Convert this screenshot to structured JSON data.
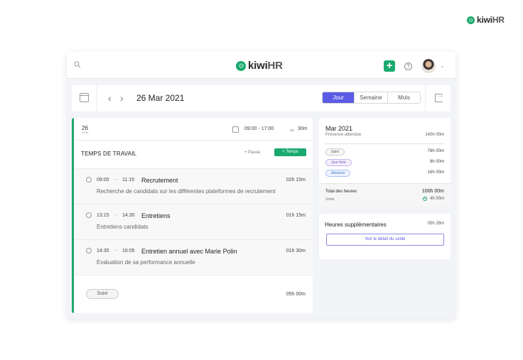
{
  "brand": {
    "name_main": "kiwi",
    "name_suffix": "HR",
    "color": "#1aaa6e"
  },
  "topbar": {
    "icons": [
      "search-icon",
      "plus-icon",
      "help-icon",
      "avatar",
      "chevron-down-icon"
    ]
  },
  "datebar": {
    "current_date": "26 Mar 2021",
    "view_options": [
      {
        "label": "Jour",
        "active": true
      },
      {
        "label": "Semaine",
        "active": false
      },
      {
        "label": "Mois",
        "active": false
      }
    ],
    "accent_color": "#5b5be6"
  },
  "day": {
    "day_number": "26",
    "day_of_week": "VEN",
    "schedule": "09:00 - 17:00",
    "pause": "30m",
    "section_title": "TEMPS DE TRAVAIL",
    "pause_button": "+ Pause",
    "temps_button": "+ Temps",
    "entries": [
      {
        "start": "09:00",
        "end": "11:15",
        "activity": "Recrutement",
        "duration": "02h 15m",
        "description": "Recherche de candidats sur les différentes plateformes de recrutement"
      },
      {
        "start": "13:15",
        "end": "14:30",
        "activity": "Entretiens",
        "duration": "01h 15m",
        "description": "Entretiens candidats"
      },
      {
        "start": "14:35",
        "end": "16:05",
        "activity": "Entretien annuel avec Marie Polin",
        "duration": "01h 30m",
        "description": "Evaluation de sa performance annuelle"
      }
    ],
    "footer_status": "Suivi",
    "footer_total": "05h 00m"
  },
  "summary": {
    "month": "Mar 2021",
    "expected_label": "Présence attendue",
    "expected_value": "140h 00m",
    "rows": [
      {
        "label": "Suivi",
        "value": "76h 00m"
      },
      {
        "label": "Jour férié",
        "value": "8h 00m"
      },
      {
        "label": "Absence",
        "value": "16h 00m"
      }
    ],
    "total_label": "Total des heures",
    "total_value": "100h 00m",
    "solde_label": "Solde",
    "solde_value": "4h 00m"
  },
  "overtime": {
    "title": "Heures supplémentaires",
    "value": "05h 28m",
    "button": "Voir le détail du solde"
  }
}
